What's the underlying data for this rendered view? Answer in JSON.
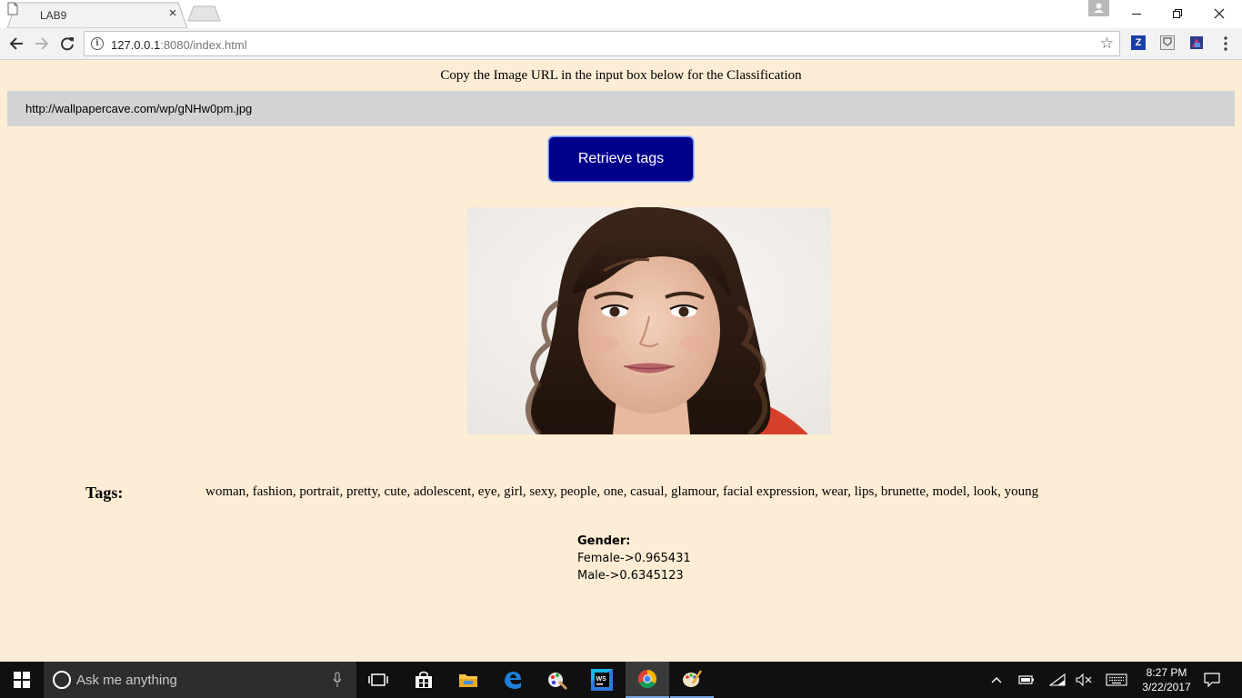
{
  "browser": {
    "tab_title": "LAB9",
    "tab_close": "×",
    "url_host": "127.0.0.1",
    "url_path": ":8080/index.html",
    "star": "☆",
    "extensions": [
      {
        "name": "zotero-extension-icon",
        "label": "Z",
        "color": "#1a3ea8"
      },
      {
        "name": "shield-extension-icon",
        "label": "◙",
        "color": "#777777"
      },
      {
        "name": "extension-icon",
        "label": "",
        "color": "#2b3a8a"
      }
    ]
  },
  "page": {
    "instruction": "Copy the Image URL in the input box below for the Classification",
    "url_input_value": "http://wallpapercave.com/wp/gNHw0pm.jpg",
    "retrieve_button": "Retrieve tags",
    "tags_label": "Tags:",
    "tags_value": "woman, fashion, portrait, pretty, cute, adolescent, eye, girl, sexy, people, one, casual, glamour, facial expression, wear, lips, brunette, model, look, young",
    "gender_title": "Gender:",
    "gender_female": "Female->0.965431",
    "gender_male": "Male->0.6345123"
  },
  "taskbar": {
    "search_placeholder": "Ask me anything",
    "time": "8:27 PM",
    "date": "3/22/2017",
    "apps": [
      "task-view-icon",
      "store-icon",
      "file-explorer-icon",
      "edge-icon",
      "paint-app-icon",
      "webstorm-icon",
      "chrome-icon",
      "paint-3d-icon"
    ]
  },
  "colors": {
    "page_bg": "#fdedd4",
    "button_bg": "#00008b",
    "input_bg": "#d3d3d3"
  }
}
